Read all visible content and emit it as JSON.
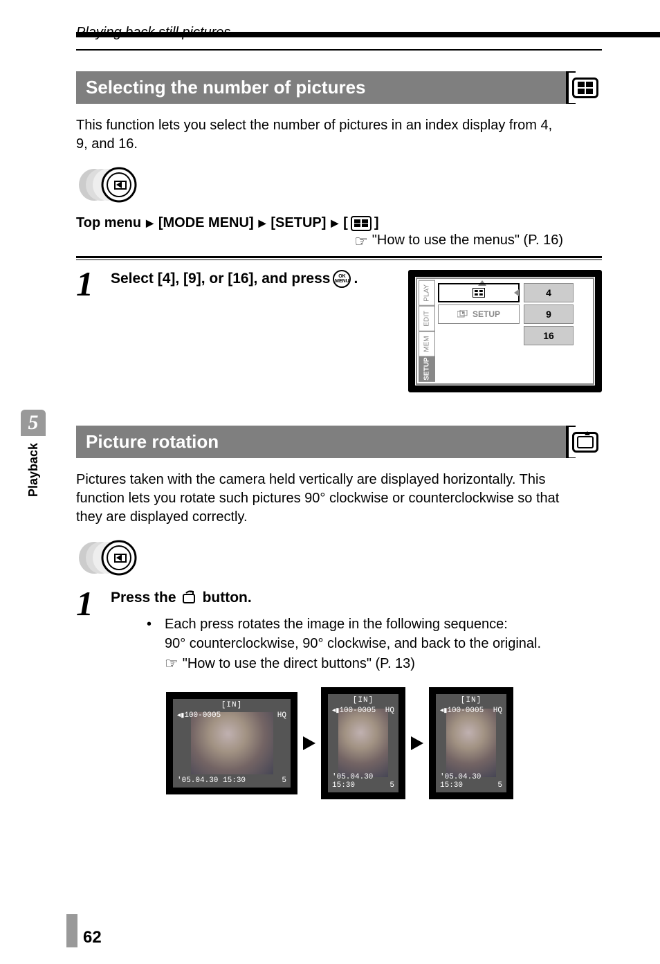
{
  "breadcrumb": "Playing back still pictures",
  "chapter": {
    "number": "5",
    "label": "Playback"
  },
  "page_number": "62",
  "section1": {
    "title": "Selecting the number of pictures",
    "intro": "This function lets you select the number of pictures in an index display from 4, 9, and 16.",
    "menupath": {
      "top": "Top menu",
      "m1": "[MODE MENU]",
      "m2": "[SETUP]"
    },
    "link": "\"How to use the menus\" (P. 16)",
    "step1": {
      "num": "1",
      "text_a": "Select [4], [9], or [16], and press ",
      "text_b": ".",
      "ok_label": "OK\nMENU"
    },
    "lcd": {
      "tabs": [
        "PLAY",
        "EDIT",
        "MEM",
        "SETUP"
      ],
      "active_index": 3,
      "setup_label": "SETUP",
      "options": [
        "4",
        "9",
        "16"
      ]
    }
  },
  "section2": {
    "title": "Picture rotation",
    "intro": "Pictures taken with the camera held vertically are displayed horizontally. This function lets you rotate such pictures 90° clockwise or counterclockwise so that they are displayed correctly.",
    "step1": {
      "num": "1",
      "text_a": "Press the ",
      "text_b": " button.",
      "bullet1": "Each press rotates the image in the following sequence:",
      "bullet2": "90° counterclockwise, 90° clockwise, and back to the original.",
      "link": "\"How to use the direct buttons\" (P. 13)"
    },
    "photos": {
      "in": "[IN]",
      "folder": "100-0005",
      "hq": "HQ",
      "date": "'05.04.30 15:30",
      "counter": "5"
    }
  }
}
